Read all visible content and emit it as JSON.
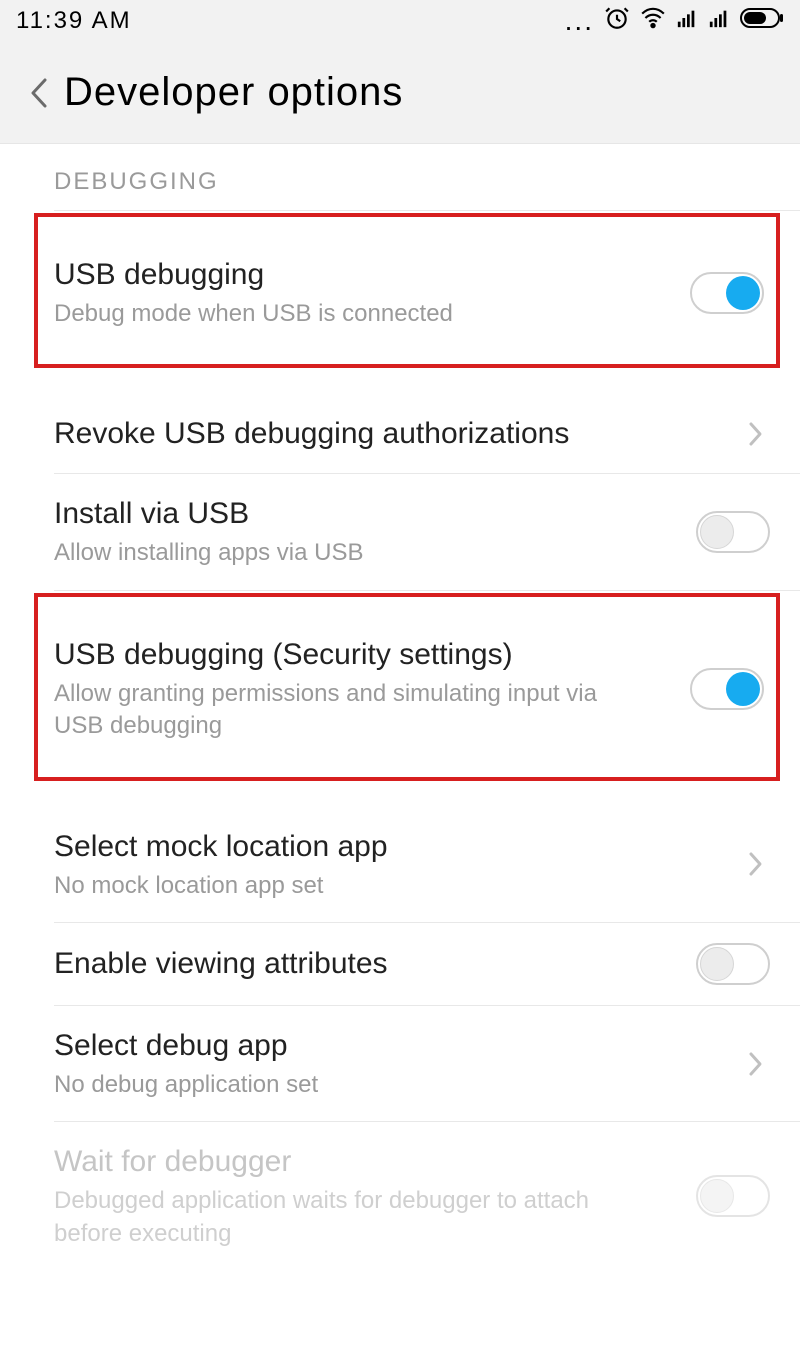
{
  "statusbar": {
    "time": "11:39  AM"
  },
  "header": {
    "title": "Developer  options"
  },
  "section": {
    "label": "DEBUGGING"
  },
  "rows": {
    "usb_debugging": {
      "title": "USB debugging",
      "sub": "Debug mode when USB is connected",
      "toggle_on": true
    },
    "revoke": {
      "title": "Revoke USB debugging authorizations"
    },
    "install_usb": {
      "title": "Install via USB",
      "sub": "Allow installing apps via USB",
      "toggle_on": false
    },
    "security": {
      "title": "USB debugging (Security settings)",
      "sub": "Allow granting permissions and simulating input via USB debugging",
      "toggle_on": true
    },
    "mock_loc": {
      "title": "Select mock location app",
      "sub": "No mock location app set"
    },
    "view_attr": {
      "title": "Enable viewing attributes",
      "toggle_on": false
    },
    "debug_app": {
      "title": "Select debug app",
      "sub": "No debug application set"
    },
    "wait_debugger": {
      "title": "Wait for debugger",
      "sub": "Debugged application waits for debugger to attach before executing",
      "toggle_on": false
    }
  }
}
